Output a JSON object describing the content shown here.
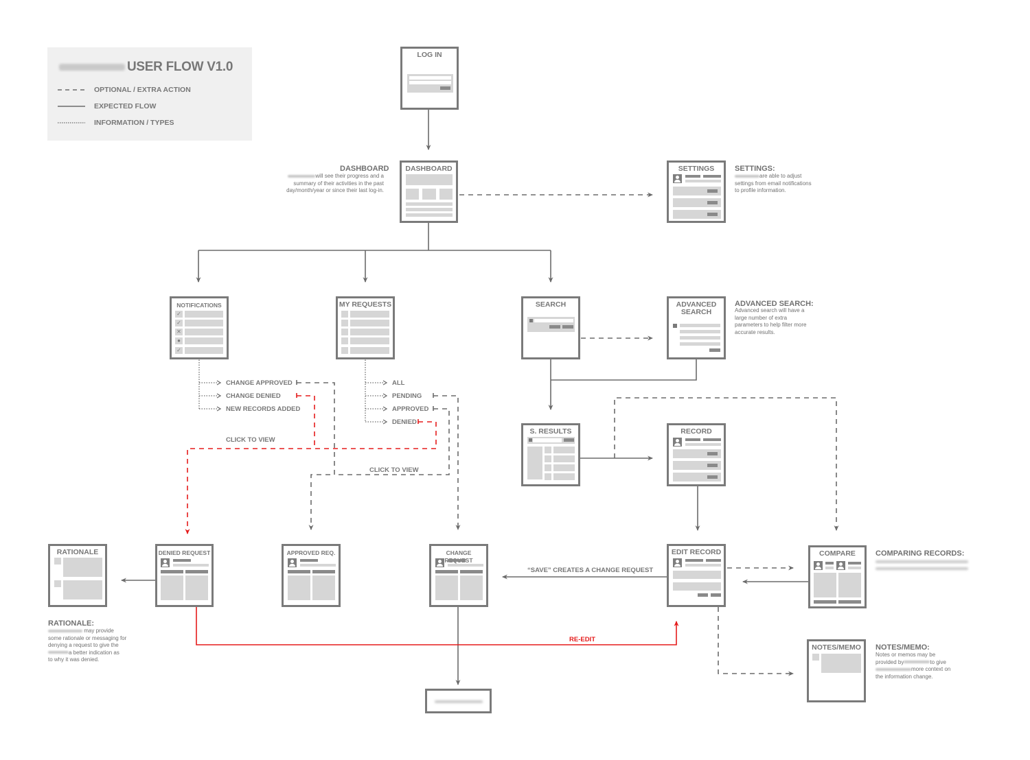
{
  "legend": {
    "title": "USER FLOW V1.0",
    "items": [
      {
        "style": "dashed",
        "label": "OPTIONAL / EXTRA ACTION"
      },
      {
        "style": "solid",
        "label": "EXPECTED FLOW"
      },
      {
        "style": "dotted",
        "label": "INFORMATION / TYPES"
      }
    ]
  },
  "colors": {
    "line": "#6b6b6b",
    "node_border": "#7a7a7a",
    "placeholder": "#d6d6d6",
    "accent_red": "#e51c1c",
    "legend_bg": "#f0f0f0"
  },
  "nodes": {
    "login": "LOG IN",
    "dashboard": "DASHBOARD",
    "settings": "SETTINGS",
    "notifications": "NOTIFICATIONS",
    "my_requests": "MY REQUESTS",
    "search": "SEARCH",
    "advanced_search": "ADVANCED SEARCH",
    "search_results": "S. RESULTS",
    "record": "RECORD",
    "rationale": "RATIONALE",
    "denied_request": "DENIED REQUEST",
    "approved_req": "APPROVED REQ.",
    "change_request": "CHANGE REQUEST",
    "edit_record": "EDIT RECORD",
    "compare": "COMPARE",
    "notes_memo": "NOTES/MEMO"
  },
  "notes": {
    "dashboard": {
      "title": "DASHBOARD",
      "lines": [
        "will see their progress and a",
        "summary of their activities in the past",
        "day/month/year or since their last log-in."
      ]
    },
    "settings": {
      "title": "SETTINGS:",
      "lines": [
        "are able to adjust",
        "settings from email notifications",
        "to profile information."
      ]
    },
    "advanced_search": {
      "title": "ADVANCED SEARCH:",
      "lines": [
        "Advanced search will have a",
        "large number of extra",
        "parameters to help filter more",
        "accurate results."
      ]
    },
    "rationale": {
      "title": "RATIONALE:",
      "lines": [
        "may provide",
        "some rationale or messaging for",
        "denying a request to give the",
        "a better indication as",
        "to why it was denied."
      ]
    },
    "comparing": {
      "title": "COMPARING RECORDS:"
    },
    "notes_memo": {
      "title": "NOTES/MEMO:",
      "lines": [
        "Notes or memos may be",
        "provided by",
        "to give",
        "more context on",
        "the information change."
      ]
    }
  },
  "notification_types": [
    "CHANGE APPROVED",
    "CHANGE DENIED",
    "NEW RECORDS ADDED"
  ],
  "notification_icons": [
    "check-icon",
    "check-icon",
    "x-icon",
    "user-icon",
    "check-icon"
  ],
  "request_filters": [
    "ALL",
    "PENDING",
    "APPROVED",
    "DENIED"
  ],
  "flow_labels": {
    "click_to_view_1": "CLICK TO VIEW",
    "click_to_view_2": "CLICK TO VIEW",
    "save_creates": "“SAVE” CREATES A CHANGE REQUEST",
    "re_edit": "RE-EDIT"
  }
}
